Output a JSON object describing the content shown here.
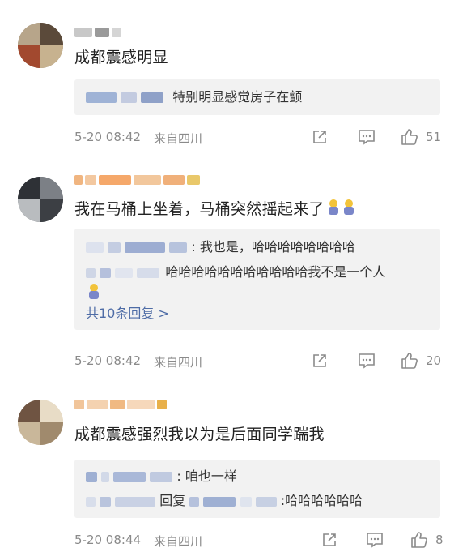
{
  "comments": [
    {
      "content": "成都震感明显",
      "reply": "特别明显感觉房子在颤",
      "time": "5-20 08:42",
      "location": "来自四川",
      "likes": "51"
    },
    {
      "content": "我在马桶上坐着，马桶突然摇起来了",
      "reply_line1": ": 我也是，哈哈哈哈哈哈哈哈",
      "reply_line2": "哈哈哈哈哈哈哈哈哈哈哈我不是一个人",
      "more_replies": "共10条回复 >",
      "time": "5-20 08:42",
      "location": "来自四川",
      "likes": "20"
    },
    {
      "content": "成都震感强烈我以为是后面同学踹我",
      "reply_line1": ": 咱也一样",
      "reply_line2_mid": "回复",
      "reply_line2_end": ":哈哈哈哈哈哈",
      "time": "5-20 08:44",
      "location": "来自四川",
      "likes": "8"
    }
  ],
  "icons": {
    "share": "share-icon",
    "comment": "comment-icon",
    "like": "thumbs-up-icon"
  },
  "colors": {
    "link": "#4e6ca6",
    "meta": "#8a8a8a",
    "reply_bg": "#f2f2f2"
  }
}
